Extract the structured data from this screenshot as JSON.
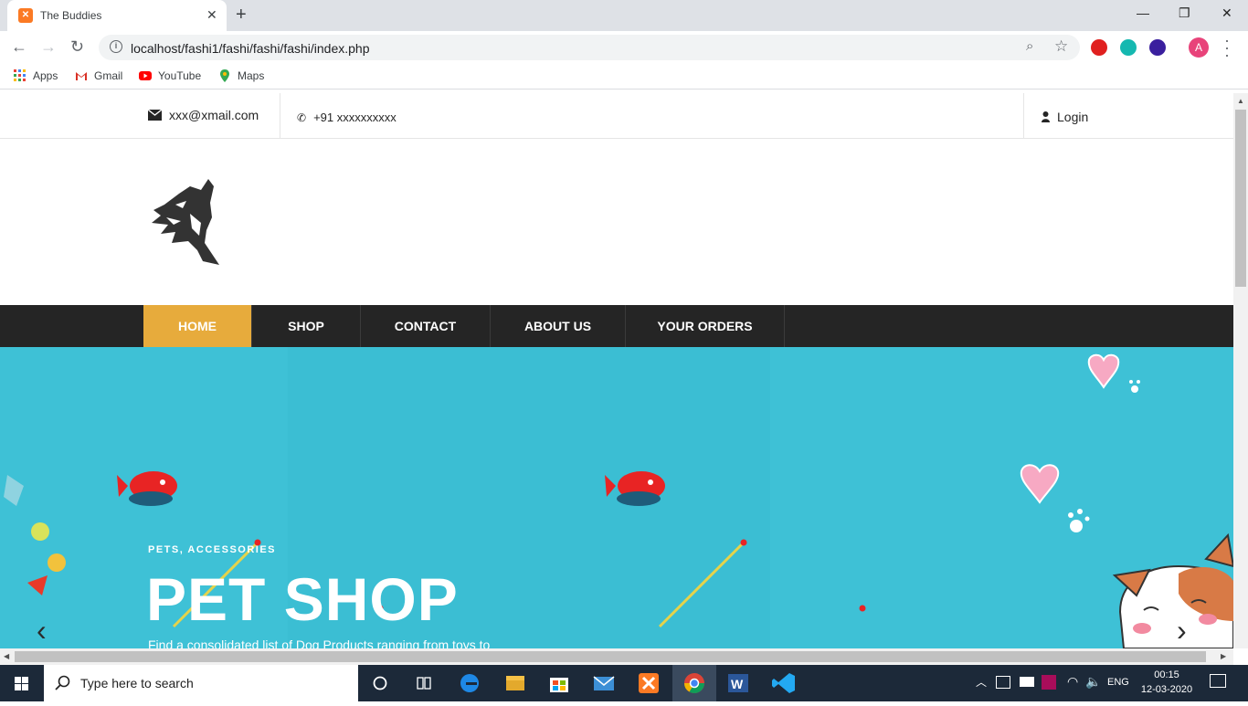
{
  "browser": {
    "tab_title": "The Buddies",
    "tab_close": "✕",
    "new_tab": "+",
    "url": "localhost/fashi1/fashi/fashi/fashi/index.php",
    "profile_initial": "A",
    "win_min": "—",
    "win_max": "❐",
    "win_close": "✕"
  },
  "bookmarks": [
    {
      "label": "Apps",
      "icon": "apps-grid-icon"
    },
    {
      "label": "Gmail",
      "icon": "gmail-icon"
    },
    {
      "label": "YouTube",
      "icon": "youtube-icon"
    },
    {
      "label": "Maps",
      "icon": "maps-icon"
    }
  ],
  "site": {
    "email": "xxx@xmail.com",
    "phone": "+91 xxxxxxxxxx",
    "login": "Login",
    "nav": [
      "HOME",
      "SHOP",
      "CONTACT",
      "ABOUT US",
      "YOUR ORDERS"
    ],
    "active_nav": "HOME",
    "hero": {
      "tag": "PETS, ACCESSORIES",
      "title": "PET SHOP",
      "description": "Find a consolidated list of Dog Products ranging from toys to"
    },
    "colors": {
      "accent": "#e7ab3c",
      "nav_bg": "#252525",
      "hero_bg": "#3ec1d6"
    }
  },
  "taskbar": {
    "search_placeholder": "Type here to search",
    "language": "ENG",
    "time": "00:15",
    "date": "12-03-2020"
  }
}
